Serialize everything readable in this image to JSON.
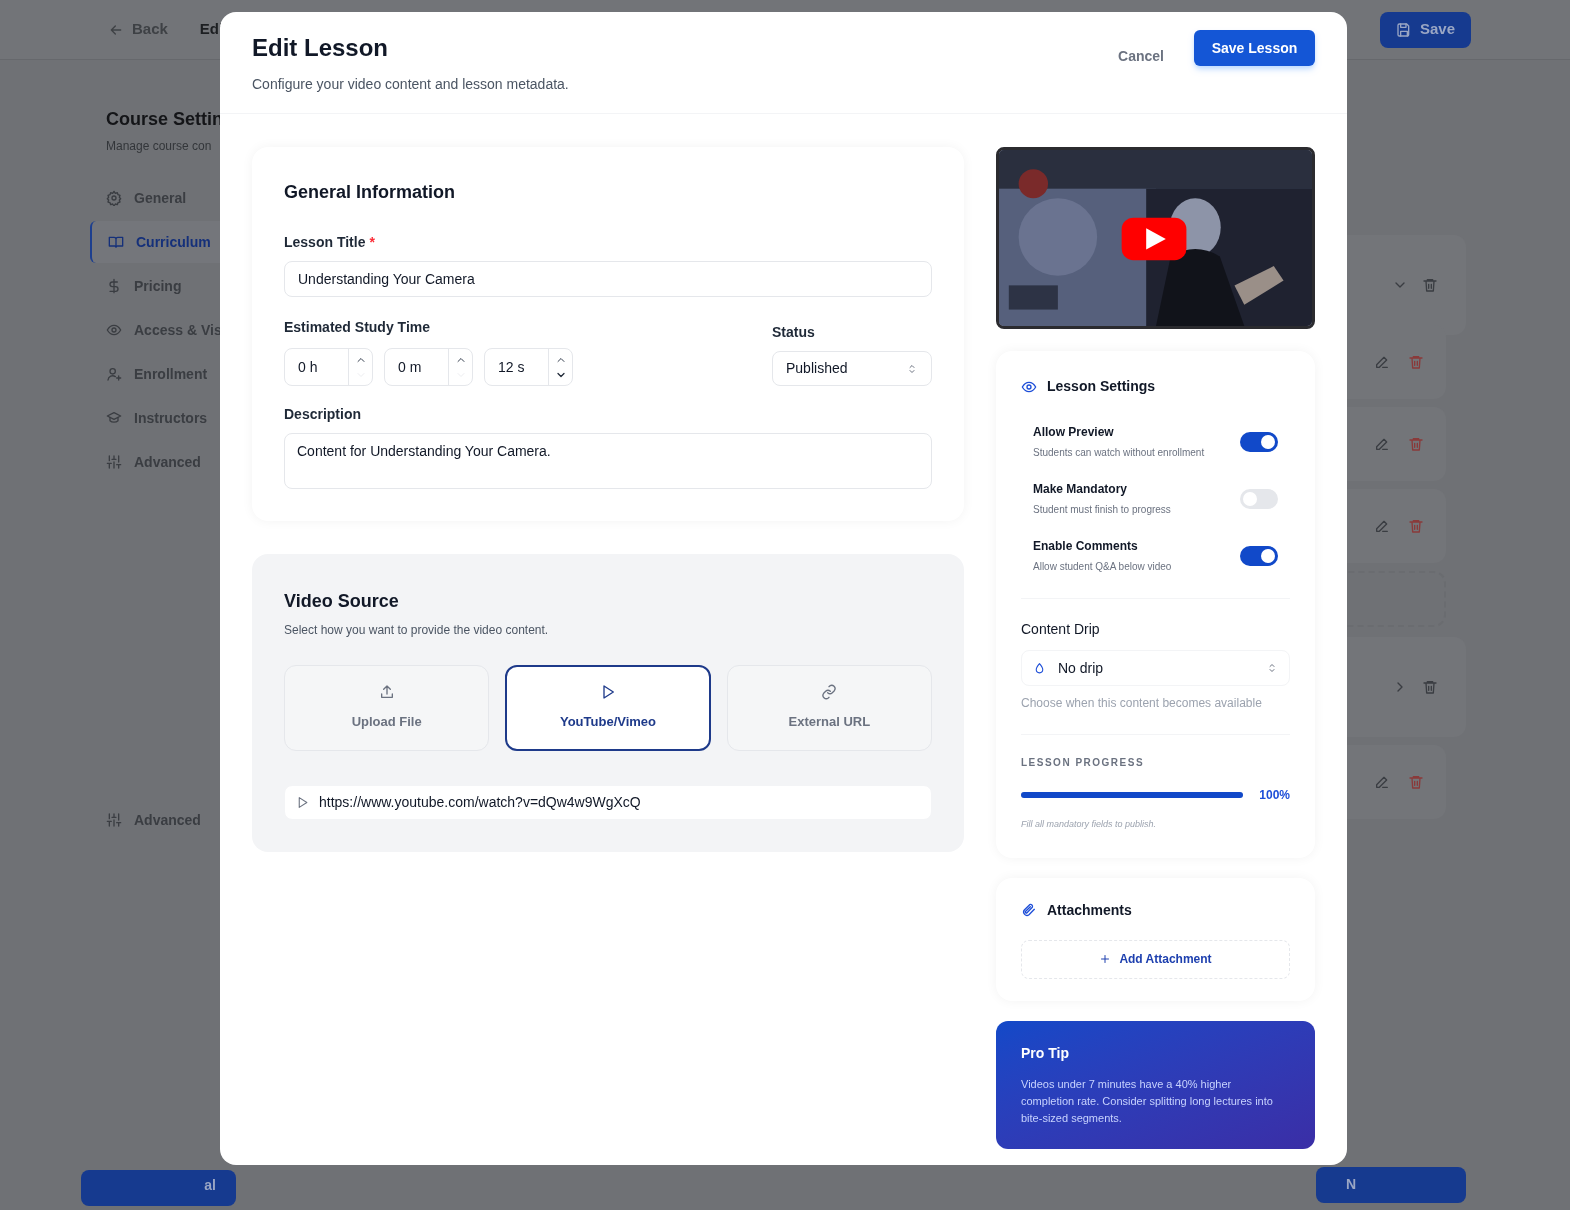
{
  "background": {
    "back": "Back",
    "title": "Edi",
    "save": "Save",
    "heading": "Course Settin",
    "subheading": "Manage course con",
    "nav": [
      {
        "label": "General",
        "selected": false
      },
      {
        "label": "Curriculum",
        "selected": true
      },
      {
        "label": "Pricing",
        "selected": false
      },
      {
        "label": "Access & Vis",
        "selected": false
      },
      {
        "label": "Enrollment",
        "selected": false
      },
      {
        "label": "Instructors",
        "selected": false
      },
      {
        "label": "Advanced",
        "selected": false
      }
    ],
    "nav_footer": {
      "label": "Advanced"
    },
    "rows": [
      {
        "kind": "section",
        "expanded": true
      },
      {
        "kind": "lesson"
      },
      {
        "kind": "lesson"
      },
      {
        "kind": "lesson"
      },
      {
        "kind": "placeholder"
      },
      {
        "kind": "section",
        "expanded": false
      },
      {
        "kind": "lesson"
      }
    ],
    "bottom_left": "al",
    "bottom_right": "N"
  },
  "modal": {
    "title": "Edit Lesson",
    "subtitle": "Configure your video content and lesson metadata.",
    "cancel": "Cancel",
    "save": "Save Lesson",
    "general": {
      "heading": "General Information",
      "title_label": "Lesson Title",
      "required_mark": "*",
      "title_value": "Understanding Your Camera",
      "time_label": "Estimated Study Time",
      "time_fields": [
        {
          "value": "0 h",
          "down_disabled": true
        },
        {
          "value": "0 m",
          "down_disabled": true
        },
        {
          "value": "12 s",
          "down_disabled": false
        }
      ],
      "status_label": "Status",
      "status_value": "Published",
      "description_label": "Description",
      "description_value": "Content for Understanding Your Camera."
    },
    "video": {
      "heading": "Video Source",
      "hint": "Select how you want to provide the video content.",
      "sources": [
        {
          "label": "Upload File",
          "selected": false
        },
        {
          "label": "YouTube/Vimeo",
          "selected": true
        },
        {
          "label": "External URL",
          "selected": false
        }
      ],
      "url": "https://www.youtube.com/watch?v=dQw4w9WgXcQ"
    },
    "settings": {
      "heading": "Lesson Settings",
      "toggles": [
        {
          "label": "Allow Preview",
          "hint": "Students can watch without enrollment",
          "on": true
        },
        {
          "label": "Make Mandatory",
          "hint": "Student must finish to progress",
          "on": false
        },
        {
          "label": "Enable Comments",
          "hint": "Allow student Q&A below video",
          "on": true
        }
      ],
      "drip_label": "Content Drip",
      "drip_value": "No drip",
      "drip_hint": "Choose when this content becomes available",
      "progress_label": "LESSON PROGRESS",
      "progress": {
        "level": 1,
        "reading": "100%"
      },
      "progress_note": "Fill all mandatory fields to publish."
    },
    "attachments": {
      "heading": "Attachments",
      "add": "Add Attachment"
    },
    "tip": {
      "title": "Pro Tip",
      "text": "Videos under 7 minutes have a 40% higher completion rate. Consider splitting long lectures into bite-sized segments."
    }
  }
}
